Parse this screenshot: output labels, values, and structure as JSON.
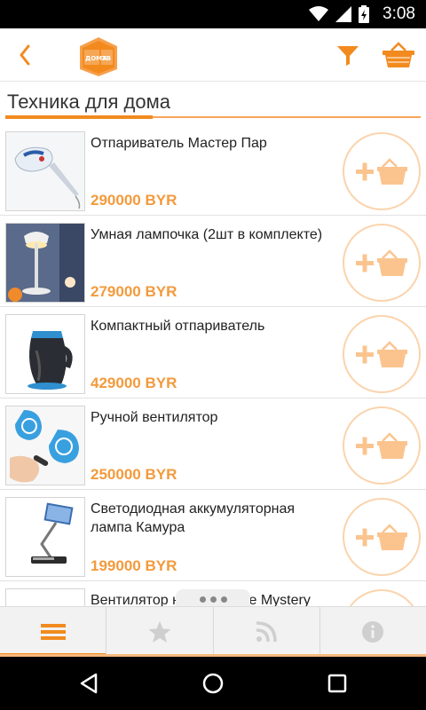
{
  "status_bar": {
    "time": "3:08"
  },
  "app": {
    "logo_text_left": "ДОМА",
    "logo_text_right": "ТВ"
  },
  "section": {
    "title": "Техника для дома"
  },
  "products": [
    {
      "name": "Отпариватель Мастер Пар",
      "price": "290000 BYR"
    },
    {
      "name": "Умная лампочка (2шт в комплекте)",
      "price": "279000 BYR"
    },
    {
      "name": "Компактный отпариватель",
      "price": "429000 BYR"
    },
    {
      "name": "Ручной вентилятор",
      "price": "250000 BYR"
    },
    {
      "name": "Светодиодная аккумуляторная лампа Камура",
      "price": "199000 BYR"
    },
    {
      "name": "Вентилятор на прищепке Mystery",
      "price": ""
    }
  ],
  "tabs": [
    {
      "icon": "menu-icon",
      "active": true
    },
    {
      "icon": "star-icon",
      "active": false
    },
    {
      "icon": "rss-icon",
      "active": false
    },
    {
      "icon": "info-icon",
      "active": false
    }
  ],
  "colors": {
    "accent": "#f28a1e",
    "price": "#f39a3c",
    "button_ring": "#fbd3ac"
  }
}
